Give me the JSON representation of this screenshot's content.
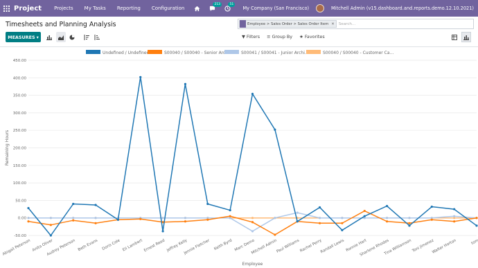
{
  "nav": {
    "brand": "Project",
    "items": [
      "Projects",
      "My Tasks",
      "Reporting",
      "Configuration"
    ],
    "messages_count": "213",
    "activities_count": "51",
    "company": "My Company (San Francisco)",
    "user": "Mitchell Admin (v15.dashboard.and.reports.demo.12.10.2021)"
  },
  "control_panel": {
    "breadcrumb": "Timesheets and Planning Analysis",
    "facet": "Employee > Sales Order > Sales Order Item",
    "search_placeholder": "Search...",
    "measures_label": "MEASURES",
    "filters_label": "Filters",
    "groupby_label": "Group By",
    "favorites_label": "Favorites"
  },
  "colors": {
    "navbar": "#71639e",
    "primary": "#017e84"
  },
  "chart_data": {
    "type": "line",
    "xlabel": "Employee",
    "ylabel": "Remaining Hours",
    "ylim": [
      -50,
      450
    ],
    "yticks": [
      "450.00",
      "400.00",
      "350.00",
      "300.00",
      "250.00",
      "200.00",
      "150.00",
      "100.00",
      "50.00",
      "0.00",
      "-50.00"
    ],
    "categories": [
      "Abigail Peterson",
      "Anita Oliver",
      "Audrey Peterson",
      "Beth Evans",
      "Doris Cole",
      "Eli Lambert",
      "Ernest Reed",
      "Jeffrey Kelly",
      "Jennie Fletcher",
      "Keith Byrd",
      "Marc Demo",
      "Mitchell Admin",
      "Paul Williams",
      "Rachel Perry",
      "Randall Lewis",
      "Ronnie Hart",
      "Sharlene Rhodes",
      "Tina Williamson",
      "Toni Jimenez",
      "Walter Horton",
      "tom"
    ],
    "legend_position": "top",
    "series": [
      {
        "name": "Undefined / Undefined",
        "color": "#1f77b4",
        "values": [
          28,
          -50,
          40,
          37,
          -5,
          402,
          -38,
          382,
          40,
          22,
          354,
          252,
          -10,
          30,
          -35,
          5,
          34,
          -22,
          32,
          25,
          -22
        ]
      },
      {
        "name": "S00040 / S00040 - Senior Archi...",
        "color": "#ff7f0e",
        "values": [
          -10,
          -20,
          -7,
          -15,
          -5,
          -3,
          -12,
          -10,
          -5,
          5,
          -12,
          -48,
          -10,
          -15,
          -15,
          20,
          -10,
          -15,
          -5,
          -10,
          0
        ]
      },
      {
        "name": "S00041 / S00041 - Junior Archi...",
        "color": "#aec7e8",
        "values": [
          0,
          0,
          0,
          0,
          0,
          0,
          0,
          0,
          0,
          0,
          -38,
          0,
          15,
          0,
          0,
          0,
          0,
          0,
          0,
          5,
          0
        ]
      },
      {
        "name": "S00040 / S00040 - Customer Ca...",
        "color": "#ffbb78",
        "values": [
          0,
          0,
          0,
          0,
          0,
          0,
          0,
          0,
          0,
          0,
          0,
          0,
          0,
          0,
          0,
          0,
          0,
          0,
          0,
          0,
          0
        ]
      }
    ]
  }
}
